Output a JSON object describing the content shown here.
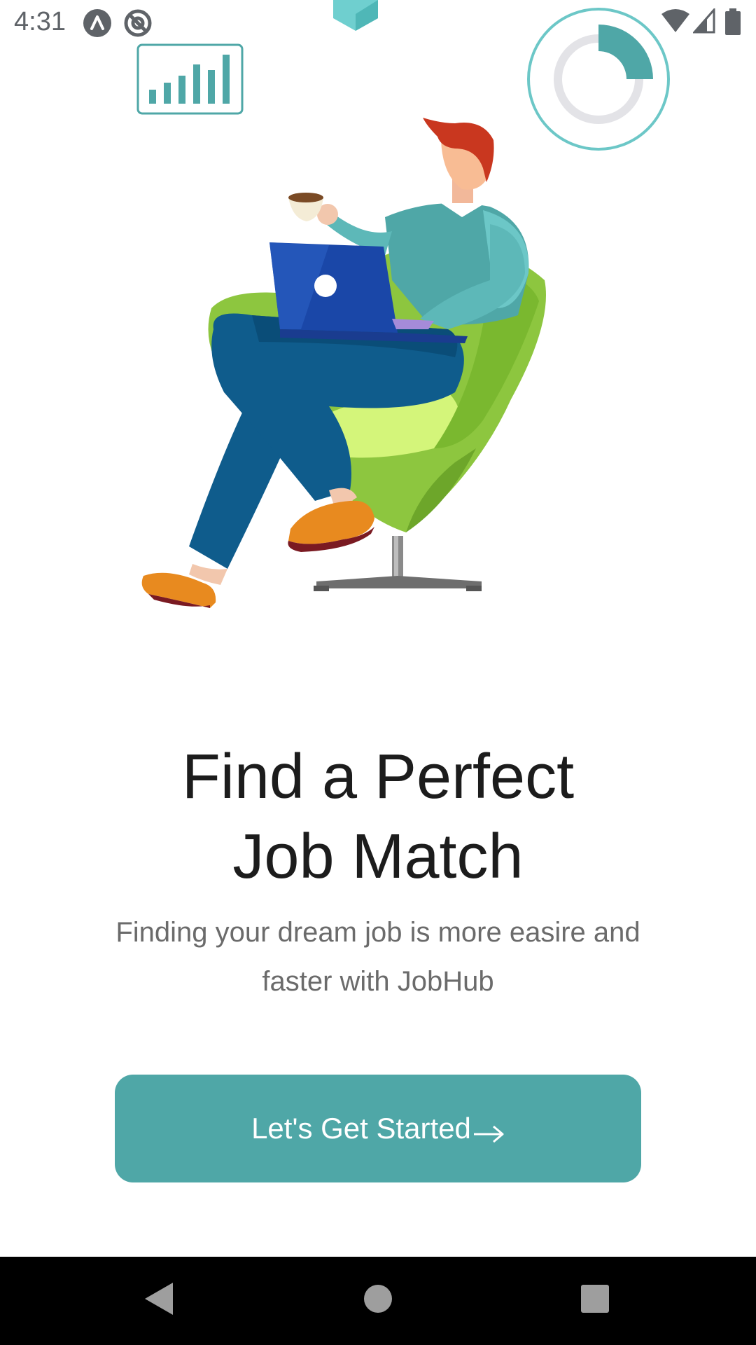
{
  "status_bar": {
    "time": "4:31",
    "left_icons": [
      "app-a-icon",
      "at-sign-icon"
    ],
    "right_icons": [
      "wifi-icon",
      "signal-icon",
      "battery-icon"
    ]
  },
  "onboarding": {
    "headline_line1": "Find a Perfect",
    "headline_line2": "Job Match",
    "subtitle": "Finding your dream job is more easire and faster with JobHub",
    "cta_label": "Let's Get Started"
  },
  "decorations": {
    "progress_ring_fraction": 0.25
  },
  "colors": {
    "accent": "#4fa7a7",
    "chair_green": "#8dc63f",
    "laptop_blue": "#1a47a8",
    "pants_blue": "#0f5c8c",
    "hair_red": "#c9371f"
  },
  "nav_bar": {
    "icons": [
      "back-icon",
      "home-icon",
      "recents-icon"
    ]
  }
}
